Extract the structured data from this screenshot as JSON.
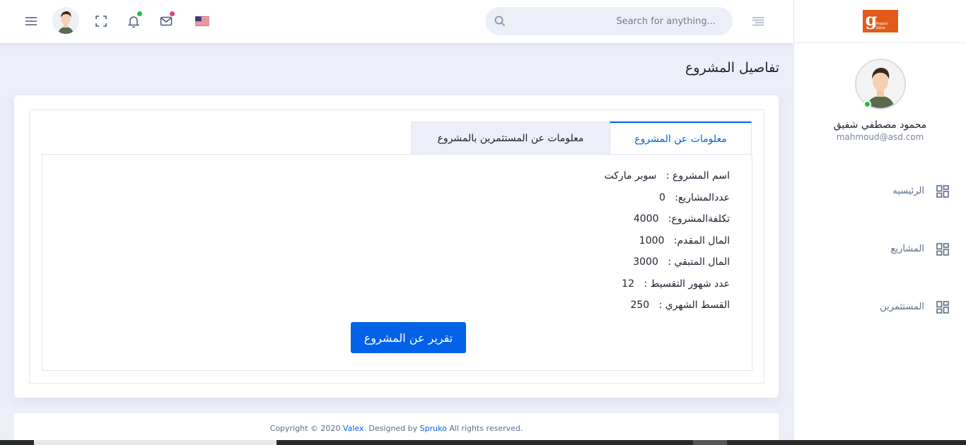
{
  "header": {
    "search_placeholder": "Search for anything...",
    "notification_dot_color": "#22c03c",
    "mail_dot_color": "#f1388b",
    "icons": [
      "menu-icon",
      "avatar",
      "fullscreen-icon",
      "bell-icon",
      "mail-icon",
      "us-flag-icon",
      "search-icon",
      "align-icon"
    ]
  },
  "sidebar": {
    "logo_text": "g",
    "logo_sub": "Project Done",
    "user_name": "محمود مصطفي شفيق",
    "user_email": "mahmoud@asd.com",
    "items": [
      {
        "label": "الرئيسيه",
        "icon": "grid-icon"
      },
      {
        "label": "المشاريع",
        "icon": "grid-icon"
      },
      {
        "label": "المستثمرين",
        "icon": "grid-icon"
      }
    ]
  },
  "main": {
    "page_title": "تفاصيل المشروع",
    "tabs": [
      {
        "label": "معلومات عن المشروع",
        "active": true
      },
      {
        "label": "معلومات عن المستثمرين بالمشروع",
        "active": false
      }
    ],
    "details": [
      {
        "label": "اسم المشروع :",
        "value": "سوبر ماركت"
      },
      {
        "label": "عددالمشاريع:",
        "value": "0"
      },
      {
        "label": "تكلفةالمشروع:",
        "value": "4000"
      },
      {
        "label": "المال المقدم:",
        "value": "1000"
      },
      {
        "label": "المال المتبقي :",
        "value": "3000"
      },
      {
        "label": "عدد شهور التقسيط :",
        "value": "12"
      },
      {
        "label": "القسط الشهري :",
        "value": "250"
      }
    ],
    "report_button": "تقرير عن المشروع"
  },
  "footer": {
    "prefix": "Copyright © 2020 ",
    "brand": "Valex",
    "middle": ". Designed by ",
    "designer": "Spruko",
    "suffix": " All rights reserved."
  },
  "colors": {
    "primary": "#0162e8",
    "background": "#eceff8",
    "online": "#22c03c"
  }
}
